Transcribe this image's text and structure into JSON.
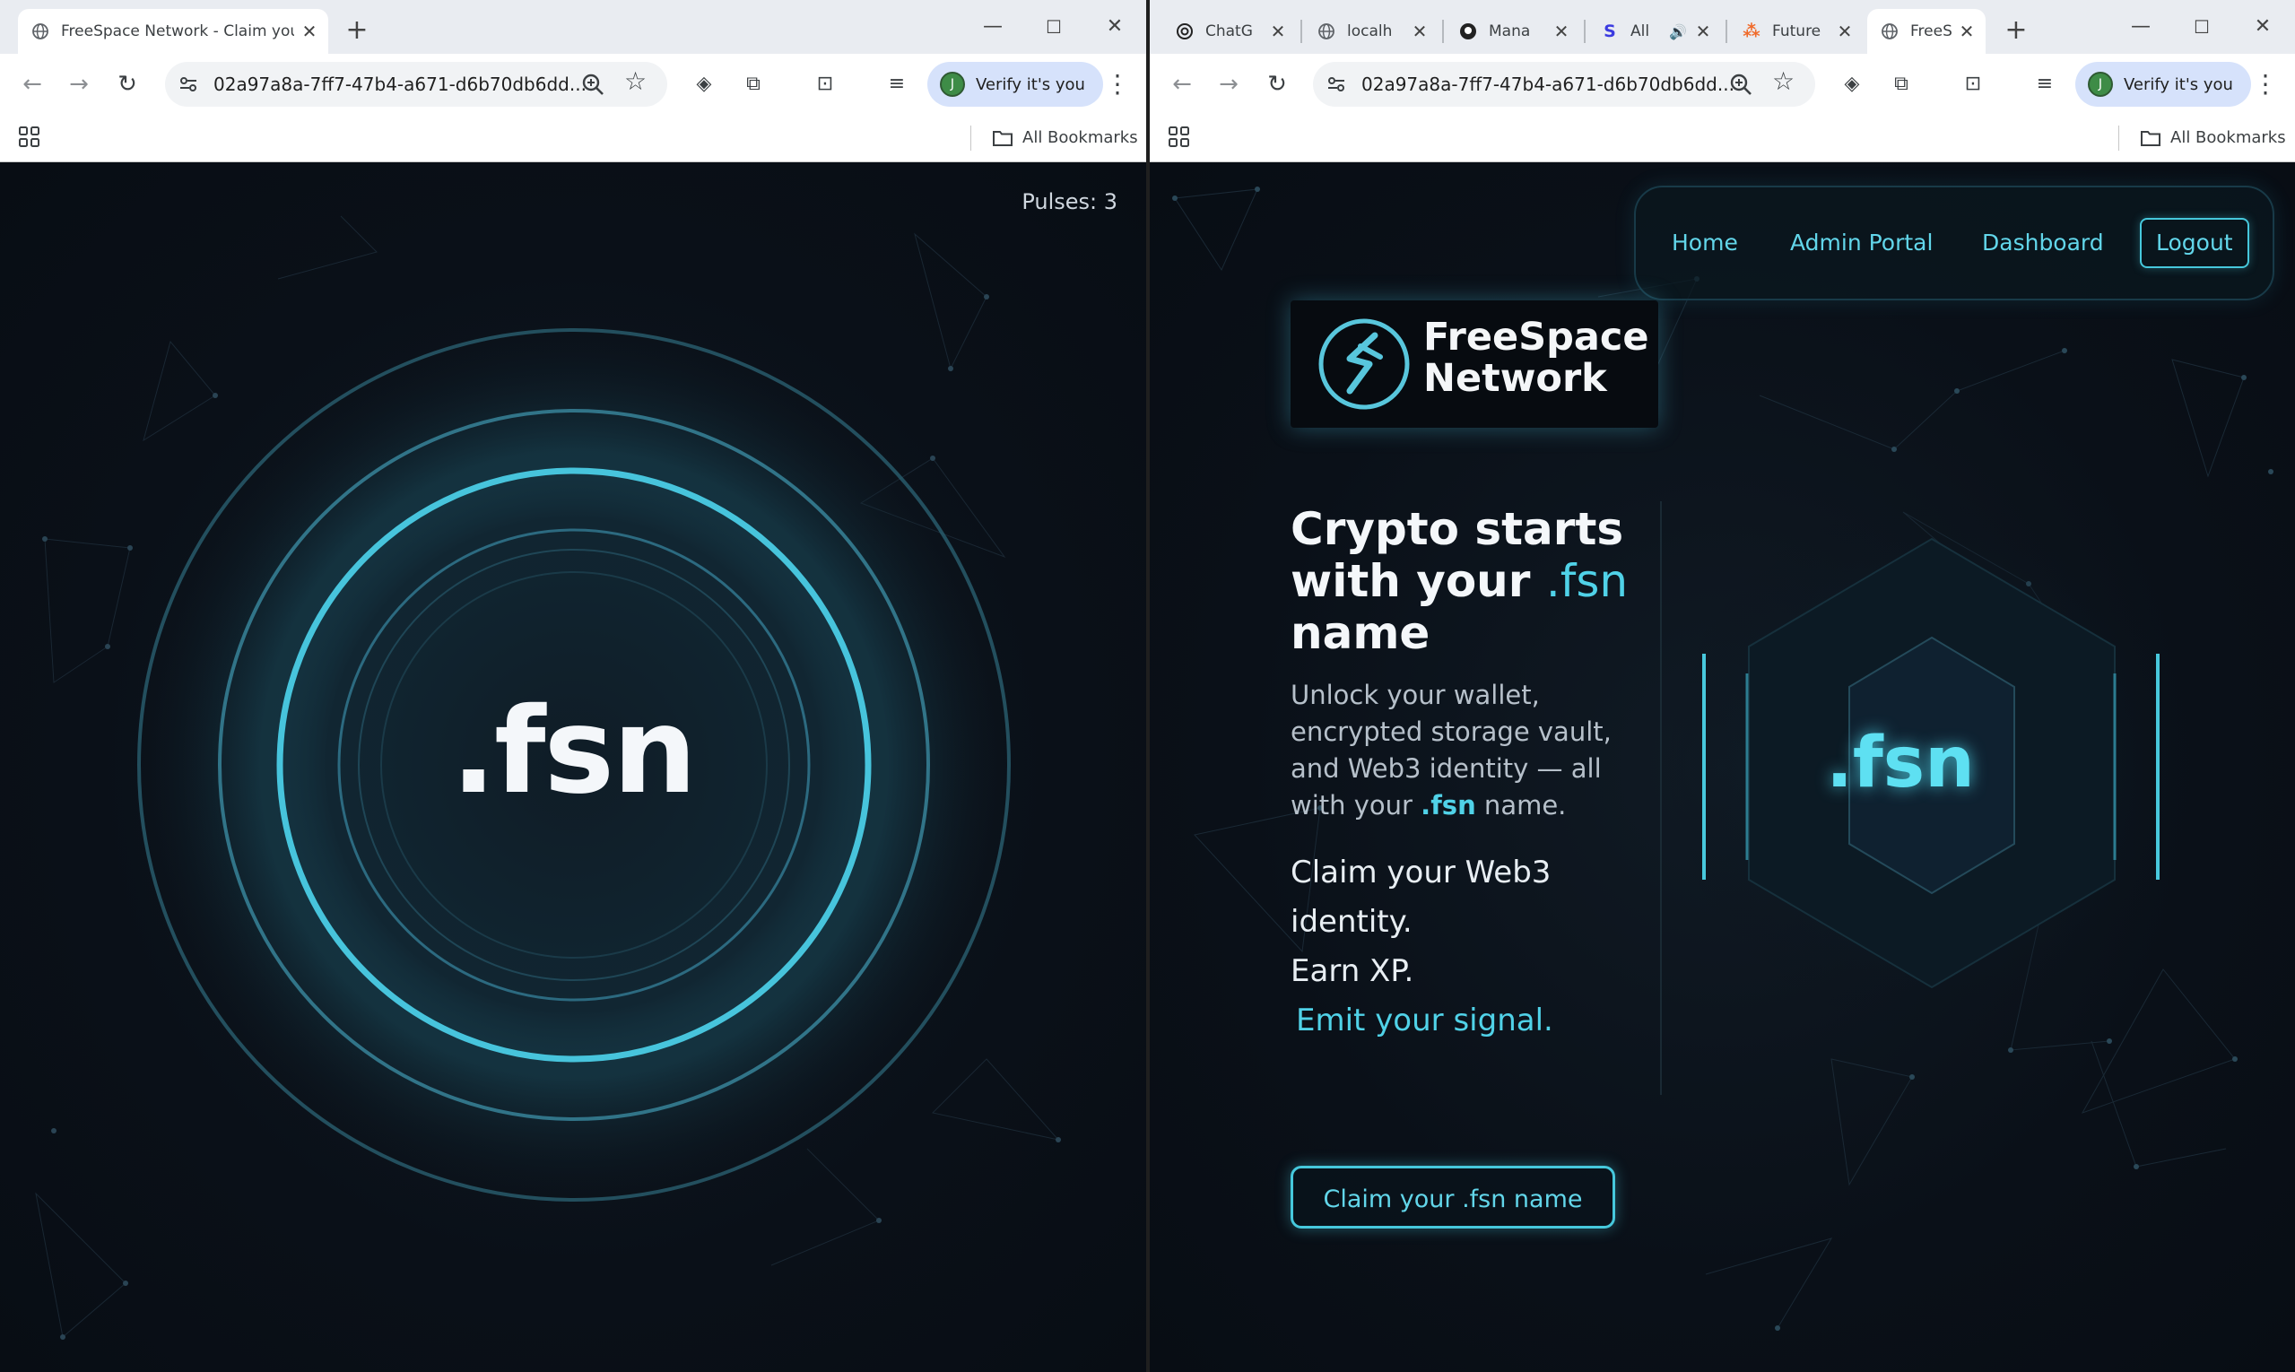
{
  "left_window": {
    "tab": {
      "title": "FreeSpace Network - Claim your"
    },
    "address": {
      "url": "02a97a8a-7ff7-47b4-a671-d6b70db6dd..."
    },
    "profile": {
      "label": "Verify it's you",
      "avatar": "J"
    },
    "bookmarks": {
      "all_label": "All Bookmarks"
    },
    "page": {
      "pulses_label": "Pulses: 3",
      "center_text": ".fsn"
    }
  },
  "right_window": {
    "tabs": [
      {
        "title": "ChatG",
        "icon": "chatgpt-icon"
      },
      {
        "title": "localh",
        "icon": "globe-icon"
      },
      {
        "title": "Mana",
        "icon": "github-icon"
      },
      {
        "title": "All",
        "icon": "s-logo-icon",
        "audio": true
      },
      {
        "title": "Future",
        "icon": "future-icon"
      },
      {
        "title": "FreeS",
        "icon": "globe-icon",
        "active": true
      }
    ],
    "address": {
      "url": "02a97a8a-7ff7-47b4-a671-d6b70db6dd..."
    },
    "profile": {
      "label": "Verify it's you",
      "avatar": "J"
    },
    "bookmarks": {
      "all_label": "All Bookmarks"
    },
    "page": {
      "nav": {
        "home": "Home",
        "admin": "Admin Portal",
        "dashboard": "Dashboard",
        "logout": "Logout"
      },
      "logo": {
        "line1": "FreeSpace",
        "line2": "Network"
      },
      "hero": {
        "title_part1": "Crypto starts with your ",
        "title_accent": ".fsn",
        "title_part2": " name",
        "subtitle_part1": "Unlock your wallet, encrypted storage vault, and Web3 identity — all with your ",
        "subtitle_accent": ".fsn",
        "subtitle_part2": " name."
      },
      "taglines": {
        "line1": "Claim your Web3",
        "line2": "identity.",
        "line3": "Earn XP.",
        "line4": "Emit your signal."
      },
      "cta": "Claim your .fsn name",
      "hex_text": ".fsn"
    }
  },
  "colors": {
    "accent": "#50d2e8",
    "background": "#0b1119"
  }
}
